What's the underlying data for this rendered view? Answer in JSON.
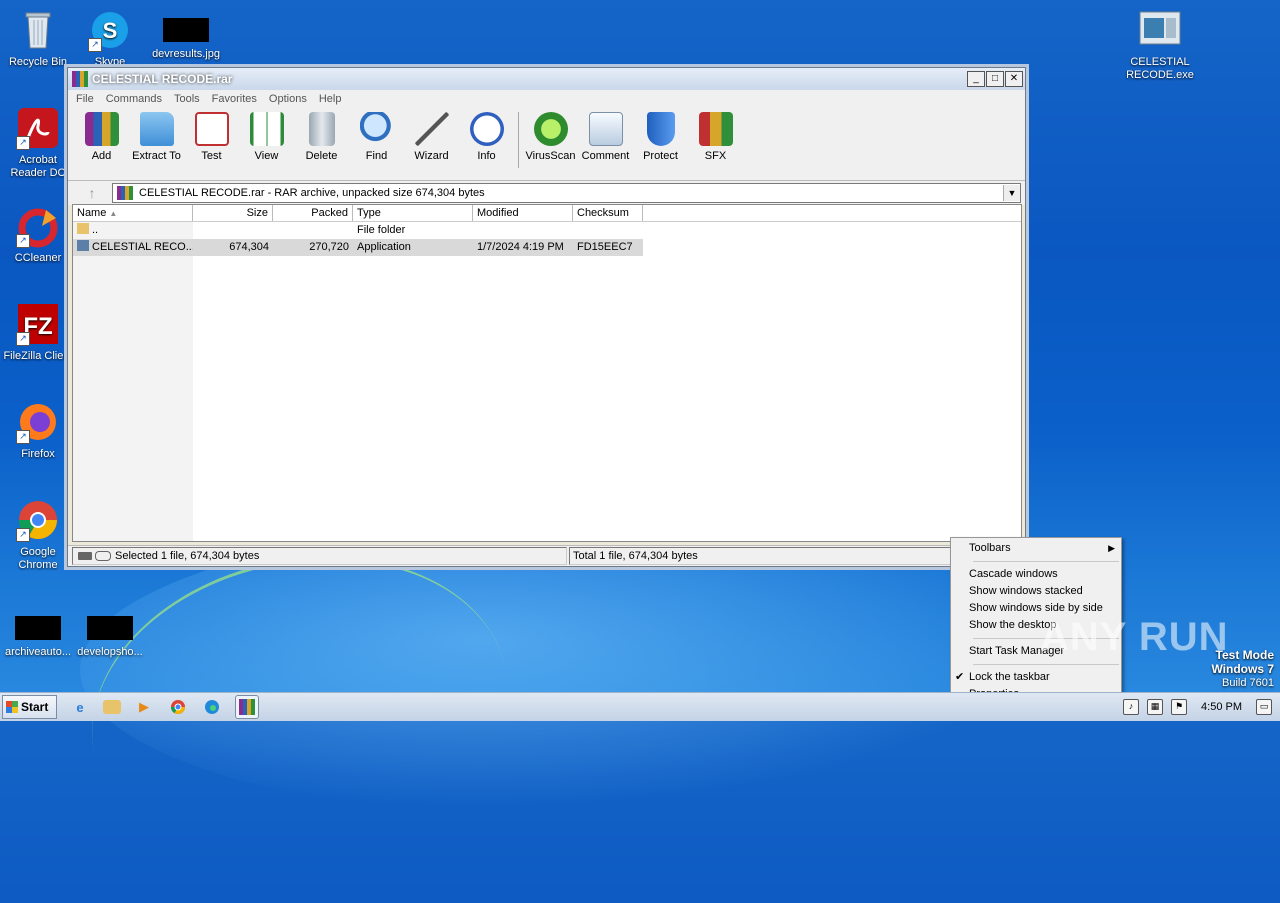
{
  "desktop": {
    "icons": [
      {
        "label": "Recycle Bin"
      },
      {
        "label": "Skype"
      },
      {
        "label": "devresults.jpg"
      },
      {
        "label": "Acrobat Reader DC"
      },
      {
        "label": "CCleaner"
      },
      {
        "label": "FileZilla Client"
      },
      {
        "label": "Firefox"
      },
      {
        "label": "Google Chrome"
      },
      {
        "label": "archiveauto..."
      },
      {
        "label": "developsho..."
      },
      {
        "label": "CELESTIAL RECODE.exe"
      }
    ]
  },
  "window": {
    "title": "CELESTIAL RECODE.rar",
    "menu": [
      "File",
      "Commands",
      "Tools",
      "Favorites",
      "Options",
      "Help"
    ],
    "toolbar": [
      "Add",
      "Extract To",
      "Test",
      "View",
      "Delete",
      "Find",
      "Wizard",
      "Info",
      "VirusScan",
      "Comment",
      "Protect",
      "SFX"
    ],
    "address": "CELESTIAL RECODE.rar - RAR archive, unpacked size 674,304 bytes",
    "columns": [
      "Name",
      "Size",
      "Packed",
      "Type",
      "Modified",
      "Checksum"
    ],
    "rows": [
      {
        "name": "..",
        "size": "",
        "packed": "",
        "type": "File folder",
        "modified": "",
        "checksum": ""
      },
      {
        "name": "CELESTIAL RECO...",
        "size": "674,304",
        "packed": "270,720",
        "type": "Application",
        "modified": "1/7/2024 4:19 PM",
        "checksum": "FD15EEC7"
      }
    ],
    "status_left": "Selected 1 file, 674,304 bytes",
    "status_right": "Total 1 file, 674,304 bytes"
  },
  "context_menu": {
    "items": [
      "Toolbars",
      "Cascade windows",
      "Show windows stacked",
      "Show windows side by side",
      "Show the desktop",
      "Start Task Manager",
      "Lock the taskbar",
      "Properties"
    ]
  },
  "watermark": {
    "text": "ANY RUN",
    "mode": "Test Mode",
    "os": "Windows 7",
    "build": "Build 7601"
  },
  "taskbar": {
    "start": "Start",
    "time": "4:50 PM"
  },
  "colors": {
    "desktop": "#0a57c1",
    "window_bg": "#f0f0f0",
    "selection": "#d9d9d9"
  }
}
